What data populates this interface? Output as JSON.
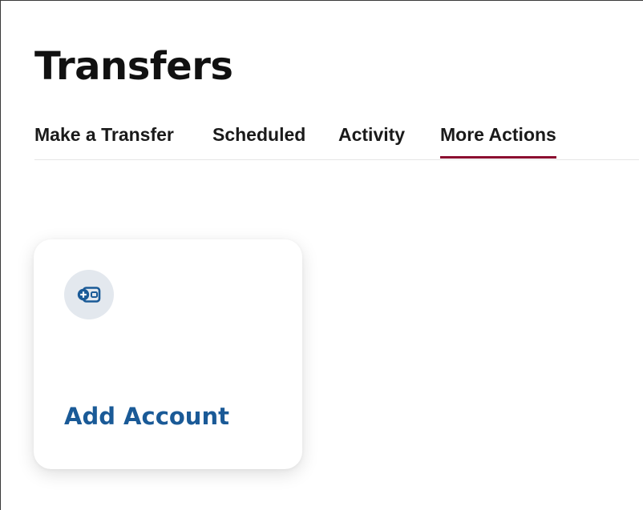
{
  "page": {
    "title": "Transfers"
  },
  "tabs": [
    {
      "label": "Make a Transfer",
      "active": false
    },
    {
      "label": "Scheduled",
      "active": false
    },
    {
      "label": "Activity",
      "active": false
    },
    {
      "label": "More Actions",
      "active": true
    }
  ],
  "actions": [
    {
      "label": "Add Account",
      "icon": "wallet-add-icon"
    }
  ],
  "colors": {
    "accent_underline": "#8b0a2f",
    "action_text": "#1a5a97",
    "icon_circle_bg": "#e3e8ee"
  }
}
